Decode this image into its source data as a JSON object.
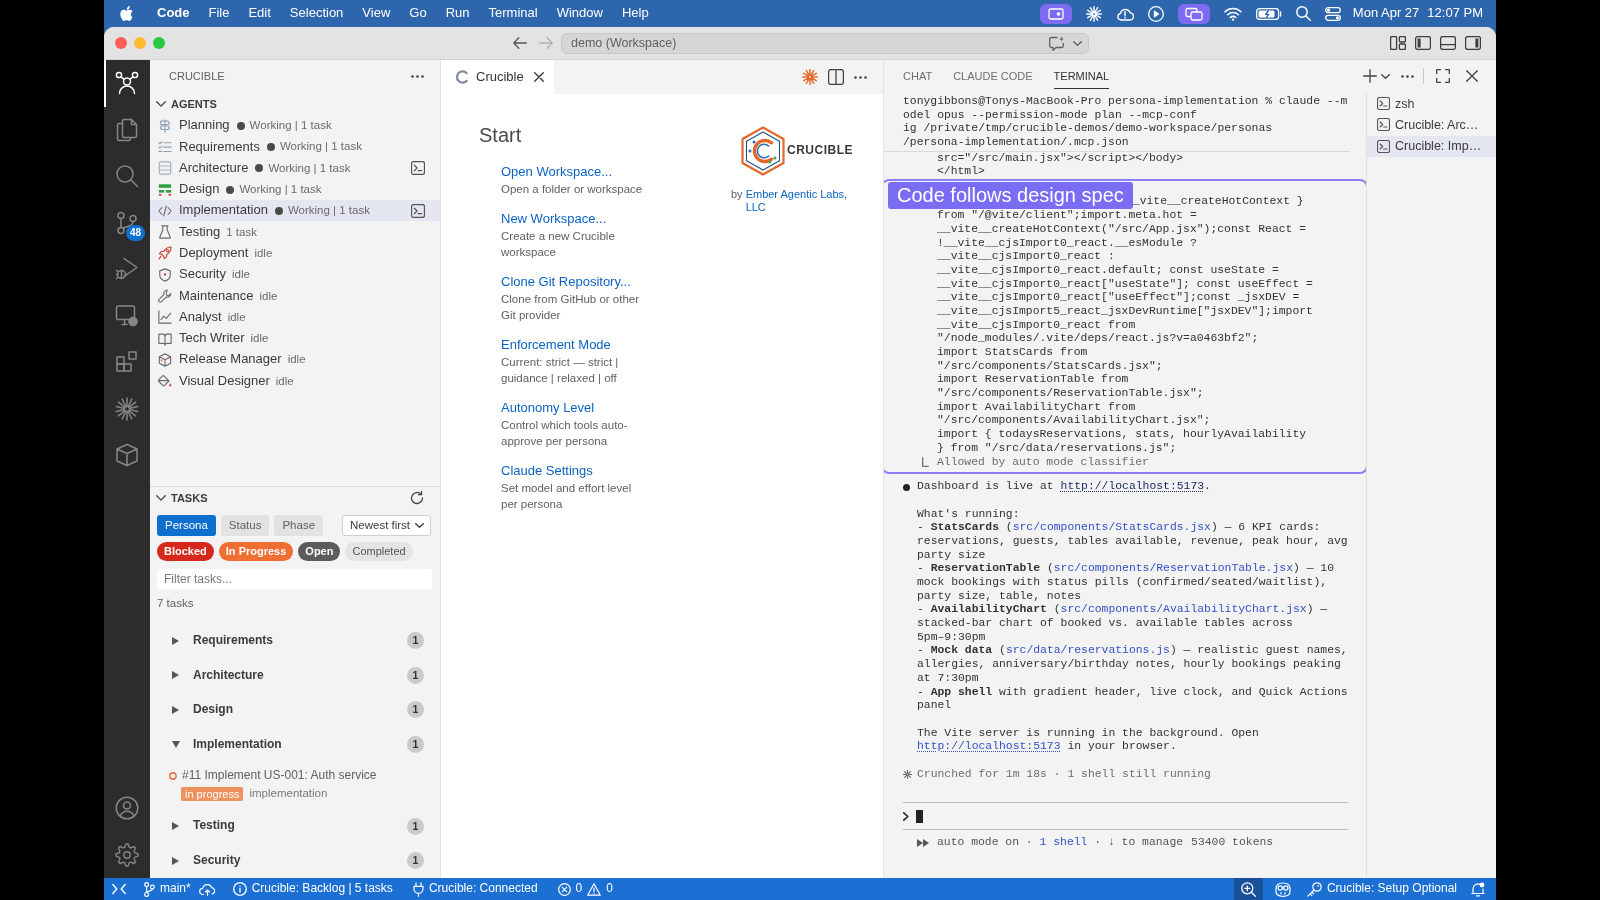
{
  "menu_bar": {
    "app": "Code",
    "menus": [
      "File",
      "Edit",
      "Selection",
      "View",
      "Go",
      "Run",
      "Terminal",
      "Window",
      "Help"
    ],
    "date": "Mon Apr 27",
    "time": "12:07 PM"
  },
  "title_bar": {
    "command_center": "demo (Workspace)"
  },
  "activity_bar": {
    "source_control_count": "48"
  },
  "sidebar": {
    "title": "CRUCIBLE",
    "agents": {
      "title": "AGENTS",
      "expanded": true,
      "items": [
        {
          "name": "Planning",
          "status": "Working | 1 task",
          "working": true,
          "terminal": false,
          "selected": false
        },
        {
          "name": "Requirements",
          "status": "Working | 1 task",
          "working": true,
          "terminal": false,
          "selected": false
        },
        {
          "name": "Architecture",
          "status": "Working | 1 task",
          "working": true,
          "terminal": true,
          "selected": false
        },
        {
          "name": "Design",
          "status": "Working | 1 task",
          "working": true,
          "terminal": false,
          "selected": false
        },
        {
          "name": "Implementation",
          "status": "Working | 1 task",
          "working": true,
          "terminal": true,
          "selected": true
        },
        {
          "name": "Testing",
          "status": "1 task",
          "working": false,
          "terminal": false,
          "selected": false
        },
        {
          "name": "Deployment",
          "status": "idle",
          "working": false,
          "terminal": false,
          "selected": false
        },
        {
          "name": "Security",
          "status": "idle",
          "working": false,
          "terminal": false,
          "selected": false
        },
        {
          "name": "Maintenance",
          "status": "idle",
          "working": false,
          "terminal": false,
          "selected": false
        },
        {
          "name": "Analyst",
          "status": "idle",
          "working": false,
          "terminal": false,
          "selected": false
        },
        {
          "name": "Tech Writer",
          "status": "idle",
          "working": false,
          "terminal": false,
          "selected": false
        },
        {
          "name": "Release Manager",
          "status": "idle",
          "working": false,
          "terminal": false,
          "selected": false
        },
        {
          "name": "Visual Designer",
          "status": "idle",
          "working": false,
          "terminal": false,
          "selected": false
        }
      ]
    },
    "tasks": {
      "title": "TASKS",
      "expanded": true,
      "group_by": [
        {
          "label": "Persona",
          "selected": true
        },
        {
          "label": "Status",
          "selected": false
        },
        {
          "label": "Phase",
          "selected": false
        }
      ],
      "sort": "Newest first",
      "status_filters": [
        {
          "label": "Blocked",
          "color": "#d7281c"
        },
        {
          "label": "In Progress",
          "color": "#ef6f33"
        },
        {
          "label": "Open",
          "color": "#5b5b5b"
        },
        {
          "label": "Completed",
          "color": "#e4e4e4"
        }
      ],
      "filter": {
        "placeholder": "Filter tasks..."
      },
      "count": "7 tasks",
      "groups": [
        {
          "name": "Requirements",
          "count": "1",
          "expanded": false
        },
        {
          "name": "Architecture",
          "count": "1",
          "expanded": false
        },
        {
          "name": "Design",
          "count": "1",
          "expanded": false
        },
        {
          "name": "Implementation",
          "count": "1",
          "expanded": true,
          "children": [
            {
              "title": "#11 Implement US-001: Auth service",
              "status": "in progress",
              "phase": "implementation"
            }
          ]
        },
        {
          "name": "Testing",
          "count": "1",
          "expanded": false
        },
        {
          "name": "Security",
          "count": "1",
          "expanded": false
        }
      ]
    }
  },
  "editor": {
    "tabs": [
      {
        "label": "Crucible",
        "selected": true
      }
    ],
    "start": {
      "heading": "Start",
      "actions": [
        {
          "label": "Open Workspace...",
          "description": "Open a folder or workspace"
        },
        {
          "label": "New Workspace...",
          "description": "Create a new Crucible workspace"
        },
        {
          "label": "Clone Git Repository...",
          "description": "Clone from GitHub or other Git provider"
        },
        {
          "label": "Enforcement Mode",
          "description": "Current: strict — strict | guidance | relaxed | off"
        },
        {
          "label": "Autonomy Level",
          "description": "Control which tools auto-approve per persona"
        },
        {
          "label": "Claude Settings",
          "description": "Set model and effort level per persona"
        }
      ]
    },
    "brand": {
      "wordmark": "CRUCIBLE",
      "credit": "by",
      "link": "Ember Agentic Labs, LLC"
    }
  },
  "panel": {
    "tabs": [
      {
        "label": "CHAT",
        "selected": false
      },
      {
        "label": "CLAUDE CODE",
        "selected": false
      },
      {
        "label": "TERMINAL",
        "selected": true
      }
    ],
    "terminal": {
      "command": [
        "tonygibbons@Tonys-MacBook-Pro persona-implementation % claude --m",
        "odel opus --permission-mode plan --mcp-conf",
        "ig /private/tmp/crucible-demos/demo-workspace/personas",
        "/persona-implementation/.mcp.json"
      ],
      "output": [
        "src=\"/src/main.jsx\"></script></body>",
        "</html>"
      ],
      "annotation": {
        "label": "Code follows design spec",
        "partial_line": "_vite__createHotContext }",
        "lines": [
          "from \"/@vite/client\";import.meta.hot =",
          "__vite__createHotContext(\"/src/App.jsx\");const React =",
          "!__vite__cjsImport0_react.__esModule ?",
          "__vite__cjsImport0_react :",
          "__vite__cjsImport0_react.default; const useState =",
          "__vite__cjsImport0_react[\"useState\"]; const useEffect =",
          "__vite__cjsImport0_react[\"useEffect\"];const _jsxDEV =",
          "__vite__cjsImport5_react_jsxDevRuntime[\"jsxDEV\"];import",
          "__vite__cjsImport0_react from",
          "\"/node_modules/.vite/deps/react.js?v=a0463bf2\";",
          "import StatsCards from",
          "\"/src/components/StatsCards.jsx\";",
          "import ReservationTable from",
          "\"/src/components/ReservationTable.jsx\";",
          "import AvailabilityChart from",
          "\"/src/components/AvailabilityChart.jsx\";",
          "import { todaysReservations, stats, hourlyAvailability",
          "} from \"/src/data/reservations.js\";"
        ],
        "note": "Allowed by auto mode classifier"
      },
      "result": {
        "lead": {
          "text": "Dashboard is live at ",
          "link": "http://localhost:5173",
          "kind": "url",
          "after": "."
        },
        "paragraphs": [
          [
            "What's running:",
            {
              "text": "- **StatsCards** (",
              "link": "src/components/StatsCards.jsx",
              "kind": "file",
              "after": ") — 6 KPI cards:"
            },
            "reservations, guests, tables available, revenue, peak hour, avg",
            "party size",
            {
              "text": "- **ReservationTable** (",
              "link": "src/components/ReservationTable.jsx",
              "kind": "file",
              "after": ") — 10"
            },
            "mock bookings with status pills (confirmed/seated/waitlist),",
            "party size, table, notes",
            {
              "text": "- **AvailabilityChart** (",
              "link": "src/components/AvailabilityChart.jsx",
              "kind": "file",
              "after": ") —"
            },
            "stacked-bar chart of booked vs. available tables across",
            "5pm–9:30pm",
            {
              "text": "- **Mock data** (",
              "link": "src/data/reservations.js",
              "kind": "file",
              "after": ") — realistic guest names,"
            },
            "allergies, anniversary/birthday notes, hourly bookings peaking",
            "at 7:30pm",
            "- **App shell** with gradient header, live clock, and Quick Actions",
            "panel"
          ],
          [
            "The Vite server is running in the background. Open",
            {
              "link": "http://localhost:5173",
              "kind": "url",
              "after": " in your browser."
            }
          ]
        ]
      },
      "status_line": "Crunched for 1m 18s · 1 shell still running",
      "footer": {
        "text": "auto mode on · ",
        "link": "1 shell",
        "after": " · ↓ to manage"
      },
      "tokens": "53400 tokens"
    },
    "terminals": [
      {
        "label": "zsh",
        "selected": false
      },
      {
        "label": "Crucible: Arc…",
        "selected": false
      },
      {
        "label": "Crucible: Imp…",
        "selected": true
      }
    ]
  },
  "status_bar": {
    "branch": "main*",
    "backlog": "Crucible: Backlog | 5 tasks",
    "connection": "Crucible: Connected",
    "errors": "0",
    "warnings": "0",
    "setup": "Crucible: Setup Optional"
  }
}
